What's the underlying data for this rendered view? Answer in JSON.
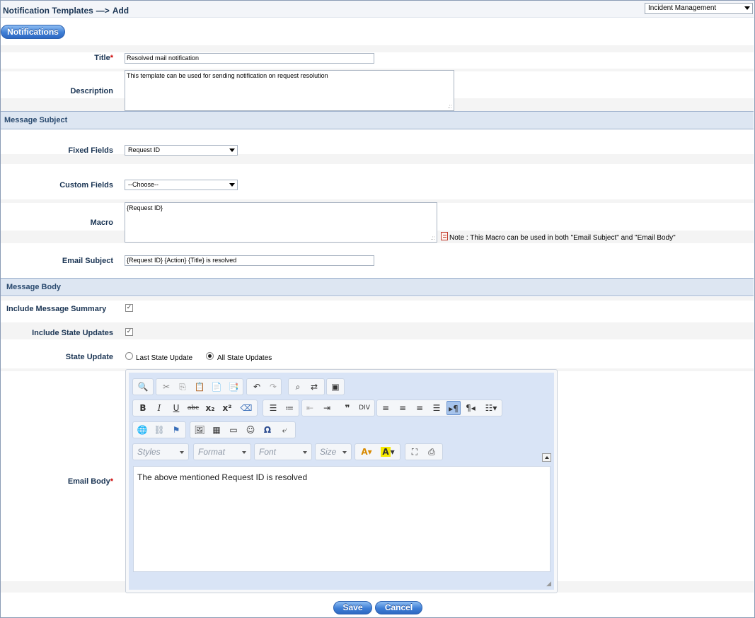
{
  "header": {
    "title": "Notification Templates",
    "arrow": "—>",
    "action": "Add",
    "module": "Incident Management"
  },
  "tabs": {
    "notifications": "Notifications"
  },
  "form": {
    "title_label": "Title",
    "title_value": "Resolved mail notification",
    "description_label": "Description",
    "description_value": "This template can be used for sending notification on request resolution",
    "message_subject_header": "Message Subject",
    "fixed_fields_label": "Fixed Fields",
    "fixed_fields_value": "Request ID",
    "custom_fields_label": "Custom Fields",
    "custom_fields_value": "--Choose--",
    "macro_label": "Macro",
    "macro_value": "{Request ID}",
    "macro_note": "Note : This Macro can be used in both \"Email Subject\" and \"Email Body\"",
    "email_subject_label": "Email Subject",
    "email_subject_value": "{Request ID} {Action} {Title} is resolved",
    "message_body_header": "Message Body",
    "include_summary_label": "Include Message Summary",
    "include_summary_checked": true,
    "include_state_updates_label": "Include State Updates",
    "include_state_updates_checked": true,
    "state_update_label": "State Update",
    "state_update_options": [
      "Last State Update",
      "All State Updates"
    ],
    "state_update_selected": "All State Updates",
    "email_body_label": "Email Body",
    "email_body_value": "The above mentioned Request ID is resolved"
  },
  "editor": {
    "styles": "Styles",
    "format": "Format",
    "font": "Font",
    "size": "Size"
  },
  "buttons": {
    "save": "Save",
    "cancel": "Cancel"
  },
  "colors": {
    "accent": "#3f7fd6",
    "label": "#1b3554",
    "section": "#dde6f2",
    "required": "#cc0000"
  }
}
